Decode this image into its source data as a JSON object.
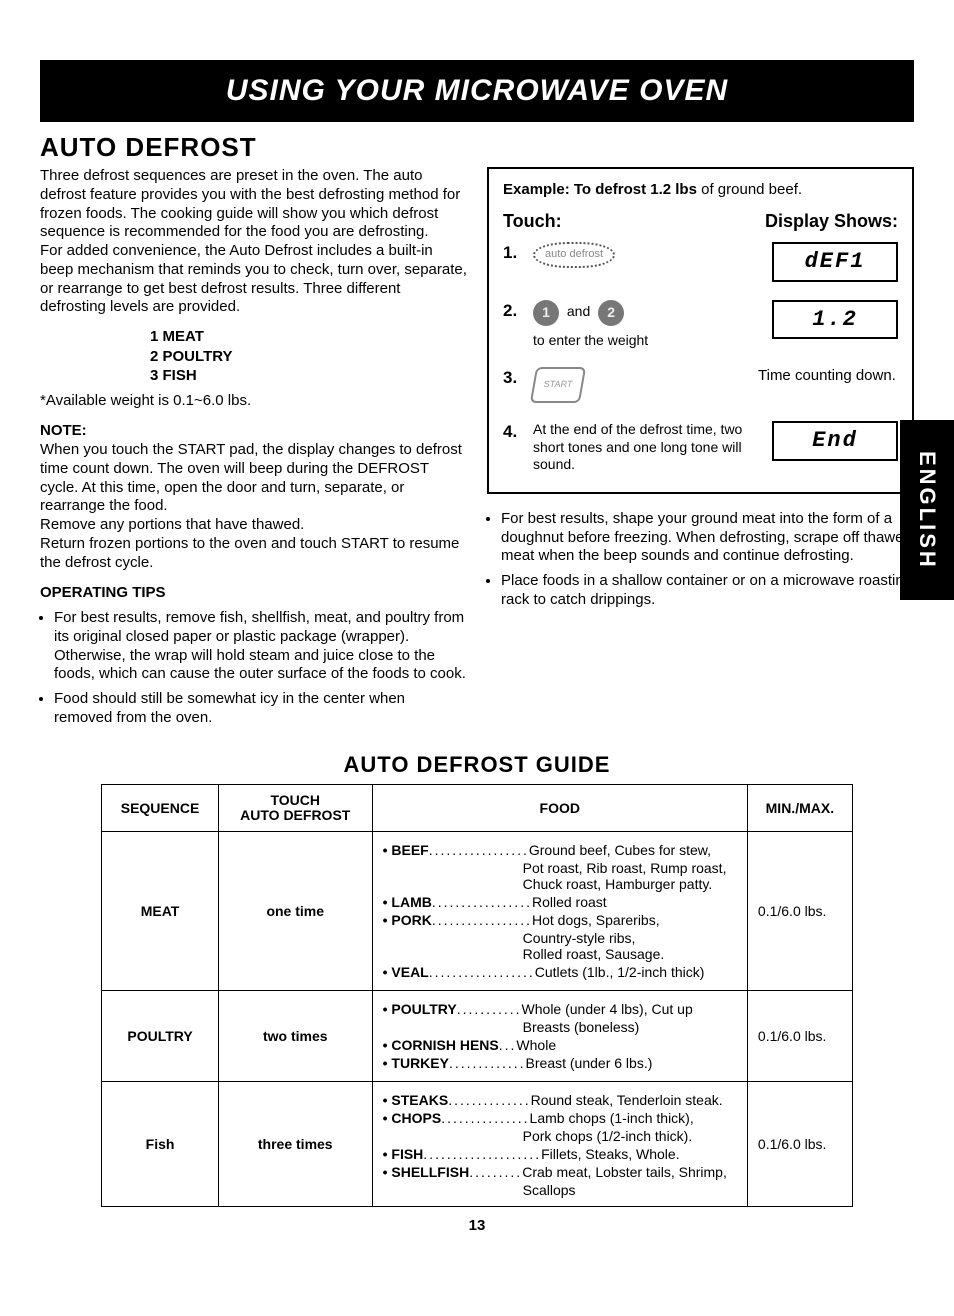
{
  "titleBar": "USING YOUR MICROWAVE OVEN",
  "section": "AUTO DEFROST",
  "intro1": "Three defrost sequences are preset in the oven. The auto defrost feature provides you with the best defrosting method for frozen foods. The cooking guide will show you which defrost sequence is recommended for the food you are defrosting.",
  "intro2": "For added convenience, the Auto Defrost includes a built-in beep mechanism that reminds you to check, turn over, separate, or rearrange to get best defrost results. Three different defrosting levels are provided.",
  "levels": {
    "l1": "1 MEAT",
    "l2": "2 POULTRY",
    "l3": "3 FISH"
  },
  "weightNote": "*Available weight is 0.1~6.0 lbs.",
  "noteH": "NOTE:",
  "noteBody": "When you touch the START pad, the display changes to defrost time count down. The oven will beep during the DEFROST cycle. At this time, open the door and turn, separate, or rearrange the food.\nRemove any portions that have thawed.\nReturn frozen portions to the oven and touch START to resume the defrost cycle.",
  "tipsH": "OPERATING TIPS",
  "tipsLeft": [
    "For best results, remove fish, shellfish, meat, and poultry from its original closed paper or plastic package (wrapper). Otherwise, the wrap will hold steam and juice close to the foods, which can cause the outer surface of the foods to cook.",
    "Food should still be somewhat icy in the center when removed from the oven."
  ],
  "tipsRight": [
    "For best results, shape your ground meat into the form of a doughnut before freezing. When defrosting, scrape off thawed meat when the beep sounds and continue defrosting.",
    "Place foods in a shallow container or on a microwave roasting rack to catch drippings."
  ],
  "example": {
    "title_b": "Example: To defrost 1.2 lbs",
    "title_rest": " of ground beef.",
    "touch": "Touch:",
    "display": "Display Shows:",
    "step1_label": "auto defrost",
    "disp1": "dEF1",
    "step2_and": "and",
    "step2_note": "to enter the weight",
    "disp2": "1.2",
    "step3_label": "START",
    "disp3text": "Time counting down.",
    "step4": "At the end of the defrost time, two short tones and one long tone will sound.",
    "disp4": "End"
  },
  "sideTab": "ENGLISH",
  "guideTitle": "AUTO DEFROST GUIDE",
  "tableHead": {
    "seq": "SEQUENCE",
    "touch1": "TOUCH",
    "touch2": "AUTO DEFROST",
    "food": "FOOD",
    "minmax": "MIN./MAX."
  },
  "rows": [
    {
      "seq": "MEAT",
      "touch": "one time",
      "minmax": "0.1/6.0 lbs.",
      "foods": [
        {
          "label": "• BEEF",
          "dots": " .................",
          "desc": "Ground beef, Cubes for stew,"
        },
        {
          "cont": "Pot roast, Rib roast, Rump roast,"
        },
        {
          "cont": "Chuck roast, Hamburger patty."
        },
        {
          "label": "• LAMB",
          "dots": " .................",
          "desc": "Rolled roast"
        },
        {
          "label": "• PORK",
          "dots": " .................",
          "desc": "Hot dogs, Spareribs,"
        },
        {
          "cont": "Country-style ribs,"
        },
        {
          "cont": "Rolled roast, Sausage."
        },
        {
          "label": "• VEAL",
          "dots": " ..................",
          "desc": "Cutlets (1lb., 1/2-inch thick)"
        }
      ]
    },
    {
      "seq": "POULTRY",
      "touch": "two times",
      "minmax": "0.1/6.0 lbs.",
      "foods": [
        {
          "label": "• POULTRY",
          "dots": " ...........",
          "desc": "Whole (under 4 lbs), Cut up"
        },
        {
          "cont": "Breasts (boneless)"
        },
        {
          "label": "• CORNISH HENS",
          "dots": " ...",
          "desc": "Whole"
        },
        {
          "label": "• TURKEY",
          "dots": " .............",
          "desc": "Breast (under 6 lbs.)"
        }
      ]
    },
    {
      "seq": "Fish",
      "touch": "three times",
      "minmax": "0.1/6.0 lbs.",
      "foods": [
        {
          "label": "• STEAKS",
          "dots": " ..............",
          "desc": "Round steak, Tenderloin steak."
        },
        {
          "label": "• CHOPS",
          "dots": " ...............",
          "desc": "Lamb chops (1-inch thick),"
        },
        {
          "cont": "Pork chops (1/2-inch thick)."
        },
        {
          "label": "• FISH",
          "dots": "....................",
          "desc": "Fillets, Steaks, Whole."
        },
        {
          "label": "• SHELLFISH",
          "dots": ".........",
          "desc": "Crab meat, Lobster tails, Shrimp,"
        },
        {
          "cont": "Scallops"
        }
      ]
    }
  ],
  "pageNum": "13"
}
